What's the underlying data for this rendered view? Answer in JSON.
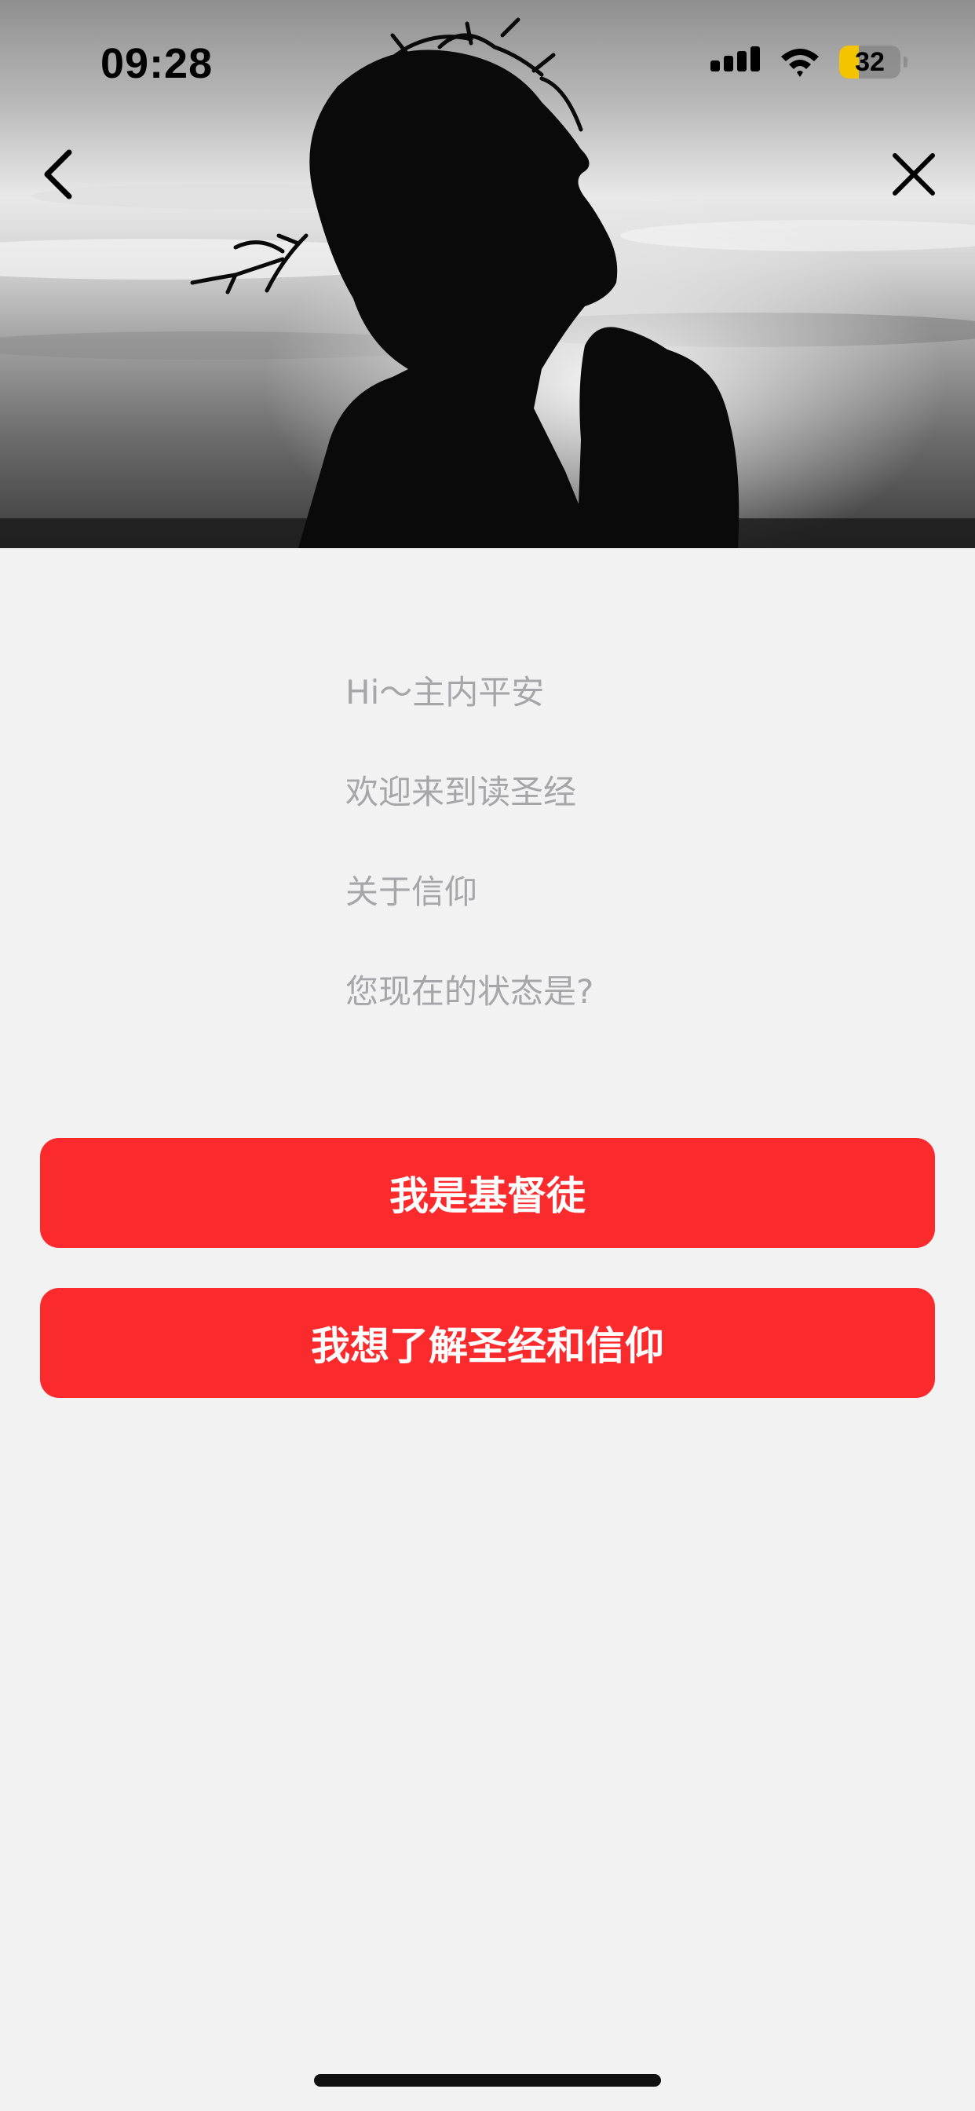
{
  "status_bar": {
    "time": "09:28",
    "battery": "32",
    "battery_level": 0.32,
    "icons": [
      "signal-icon",
      "wifi-icon",
      "battery-icon"
    ]
  },
  "nav": {
    "back_icon": "chevron-left-icon",
    "close_icon": "close-icon"
  },
  "hero": {
    "image": "silhouette of praying man with crown of thorns against grey sky"
  },
  "intro": {
    "lines": [
      "Hi～主内平安",
      "欢迎来到读圣经",
      "关于信仰",
      "您现在的状态是?"
    ]
  },
  "buttons": {
    "christian": "我是基督徒",
    "learn": "我想了解圣经和信仰"
  },
  "colors": {
    "accent": "#fb2a2d",
    "background": "#f2f2f3",
    "intro_text": "#a6a6a8",
    "battery_fill": "#f5c400"
  }
}
